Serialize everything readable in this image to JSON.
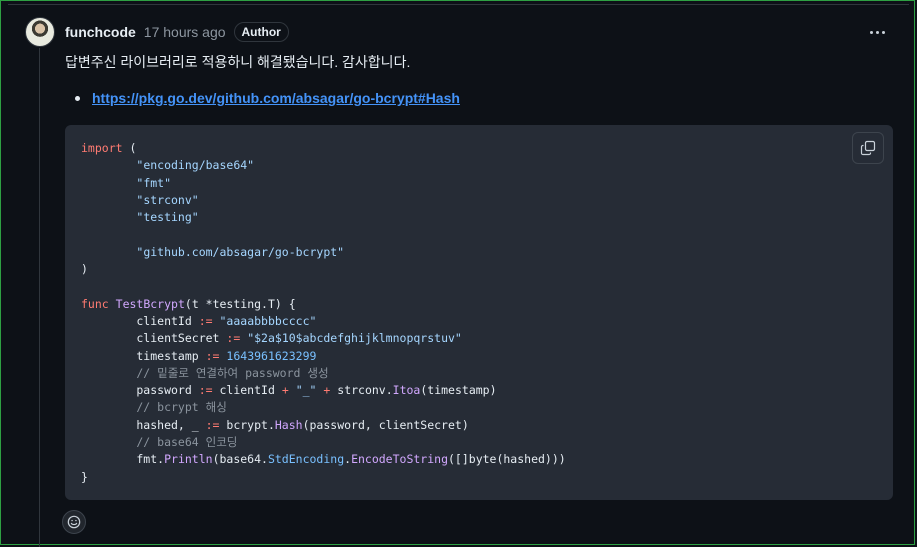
{
  "comment": {
    "author": "funchcode",
    "time": "17 hours ago",
    "badge": "Author",
    "body": "답변주신 라이브러리로 적용하니 해결됐습니다. 감사합니다.",
    "link": "https://pkg.go.dev/github.com/absagar/go-bcrypt#Hash"
  },
  "code": {
    "lines": [
      "import (",
      "        \"encoding/base64\"",
      "        \"fmt\"",
      "        \"strconv\"",
      "        \"testing\"",
      "",
      "        \"github.com/absagar/go-bcrypt\"",
      ")",
      "",
      "func TestBcrypt(t *testing.T) {",
      "        clientId := \"aaaabbbbcccc\"",
      "        clientSecret := \"$2a$10$abcdefghijklmnopqrstuv\"",
      "        timestamp := 1643961623299",
      "        // 밑줄로 연결하여 password 생성",
      "        password := clientId + \"_\" + strconv.Itoa(timestamp)",
      "        // bcrypt 해싱",
      "        hashed, _ := bcrypt.Hash(password, clientSecret)",
      "        // base64 인코딩",
      "        fmt.Println(base64.StdEncoding.EncodeToString([]byte(hashed)))",
      "}"
    ]
  },
  "icons": {
    "more": "kebab-horizontal-icon",
    "copy": "copy-icon",
    "reaction": "smiley-icon"
  }
}
